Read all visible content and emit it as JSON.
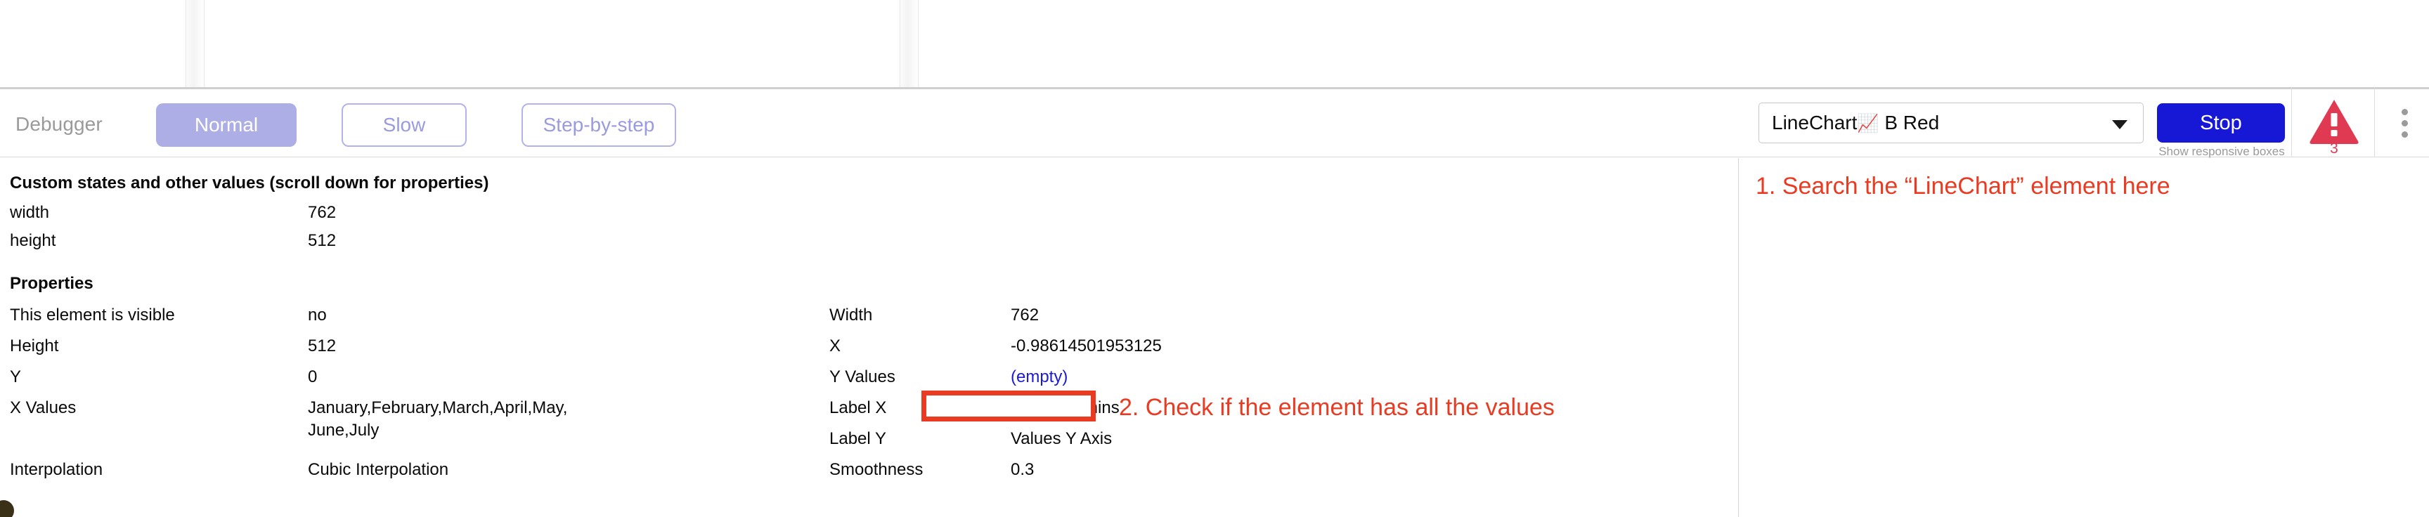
{
  "toolbar": {
    "label": "Debugger",
    "buttons": [
      {
        "name": "normal",
        "label": "Normal"
      },
      {
        "name": "slow",
        "label": "Slow"
      },
      {
        "name": "step-by-step",
        "label": "Step-by-step"
      }
    ],
    "element_select": {
      "value_prefix": "LineChart",
      "value_icon": "📈",
      "value_suffix": " B Red",
      "caret_icon": "chevron-down-icon"
    },
    "stop_button": "Stop",
    "responsive_toggle": "Show responsive boxes",
    "warning": {
      "icon": "warning-triangle-icon",
      "count": "3",
      "color": "#e03a52"
    },
    "overflow_menu": "kebab-menu-icon",
    "accent_primary": "#aeaee6",
    "accent_stop": "#1717d6"
  },
  "panel": {
    "custom_states": {
      "heading": "Custom states and other values (scroll down for properties)",
      "rows": [
        {
          "key": "width",
          "value": "762"
        },
        {
          "key": "height",
          "value": "512"
        }
      ]
    },
    "properties": {
      "heading": "Properties",
      "left_rows": [
        {
          "key": "This element is visible",
          "value": "no"
        },
        {
          "key": "Height",
          "value": "512"
        },
        {
          "key": "Y",
          "value": "0"
        },
        {
          "key": "X Values",
          "value": "January,February,March,April,May, June,July"
        },
        {
          "key": "Interpolation",
          "value": "Cubic Interpolation"
        }
      ],
      "right_rows": [
        {
          "key": "Width",
          "value": "762"
        },
        {
          "key": "X",
          "value": "-0.98614501953125"
        },
        {
          "key": "Y Values",
          "value": "(empty)",
          "highlight": true
        },
        {
          "key": "Label X",
          "value": "Users, Admins"
        },
        {
          "key": "Label Y",
          "value": "Values Y Axis"
        },
        {
          "key": "Smoothness",
          "value": "0.3"
        }
      ]
    }
  },
  "annotations": {
    "color": "#ea3a21",
    "step1": "1. Search the “LineChart” element here",
    "step2": "2. Check if the element has all the values"
  }
}
